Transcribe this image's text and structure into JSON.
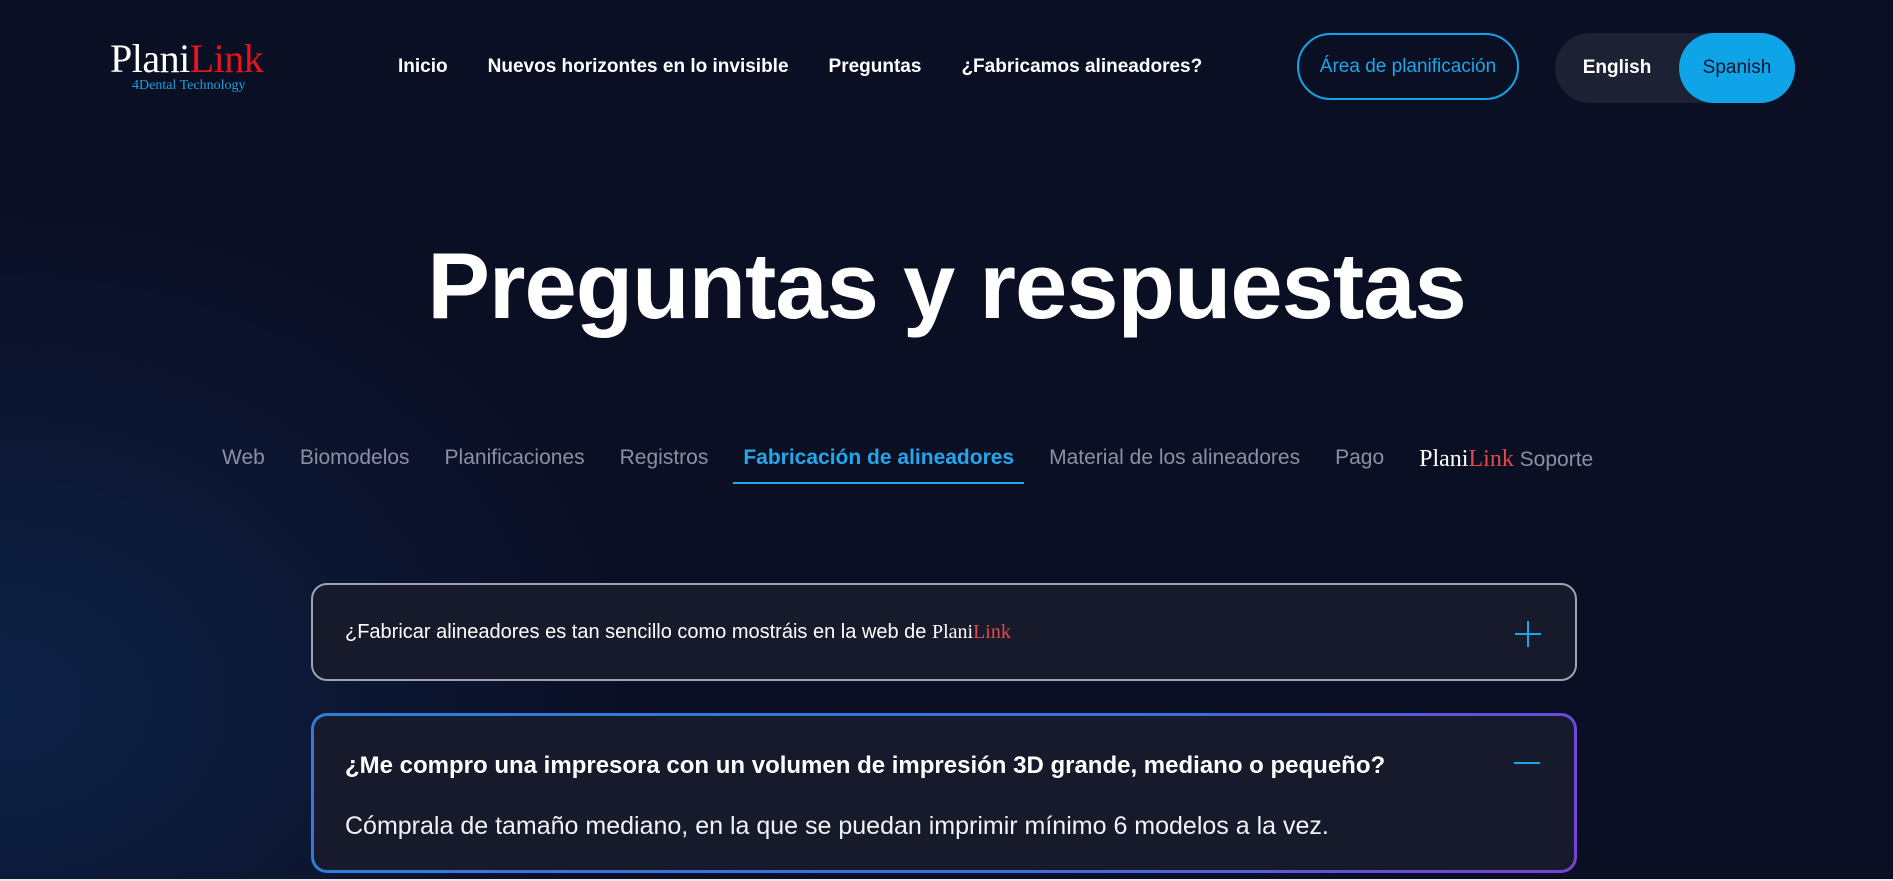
{
  "logo": {
    "plani": "Plani",
    "link": "Link",
    "subtitle": "4Dental Technology"
  },
  "nav": [
    "Inicio",
    "Nuevos horizontes en lo invisible",
    "Preguntas",
    "¿Fabricamos alineadores?"
  ],
  "planning_button": "Área de planificación",
  "language": {
    "english": "English",
    "spanish": "Spanish",
    "selected": "Spanish"
  },
  "page_title": "Preguntas y respuestas",
  "tabs": {
    "web": "Web",
    "biomodelos": "Biomodelos",
    "planificaciones": "Planificaciones",
    "registros": "Registros",
    "fabricacion": "Fabricación de alineadores",
    "material": "Material de los alineadores",
    "pago": "Pago",
    "brand_plani": "Plani",
    "brand_link": "Link",
    "soporte": "Soporte",
    "active": "Fabricación de alineadores"
  },
  "faqs": [
    {
      "question": "¿Fabricar alineadores es tan sencillo como mostráis en la web de ",
      "brand_plani": "Plani",
      "brand_link": "Link",
      "expanded": false
    },
    {
      "question": "¿Me compro una impresora con un volumen de impresión 3D grande, mediano o pequeño?",
      "answer": "Cómprala de tamaño mediano, en la que se puedan imprimir mínimo 6 modelos a la vez.",
      "expanded": true
    }
  ],
  "colors": {
    "accent": "#12a4e6",
    "logo_red": "#e8141d",
    "background": "#0b0f24"
  }
}
